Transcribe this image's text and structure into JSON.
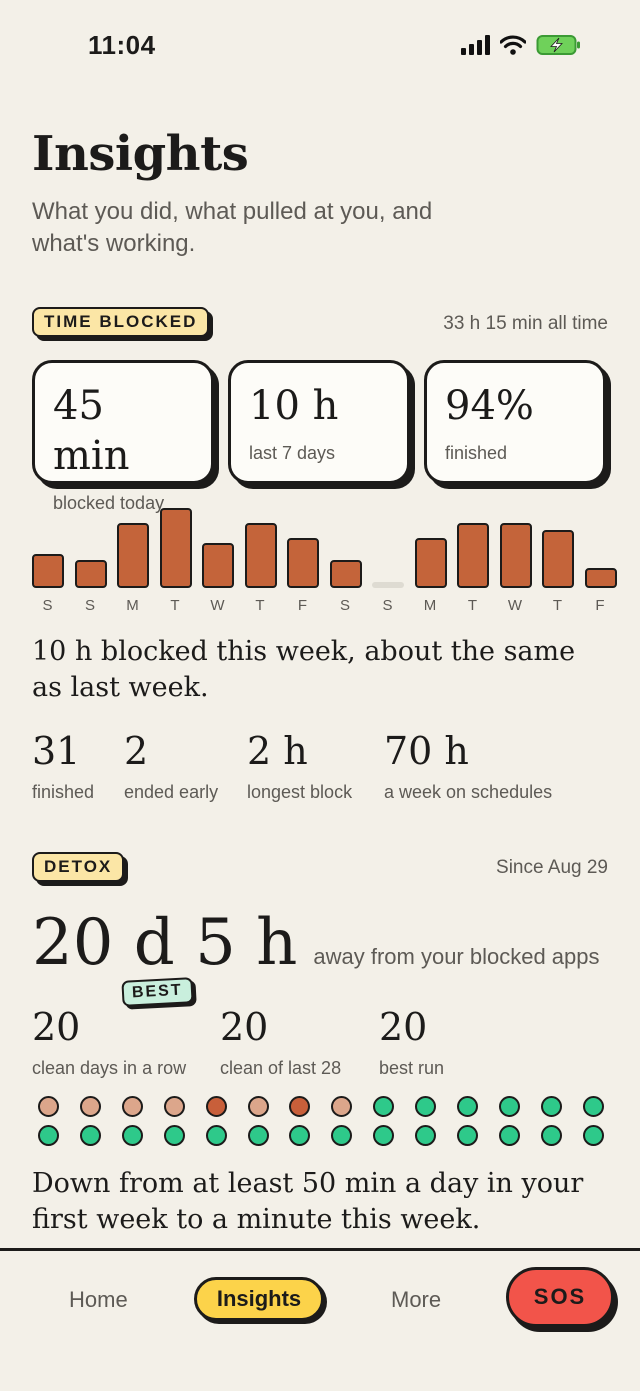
{
  "status": {
    "time": "11:04"
  },
  "header": {
    "title": "Insights",
    "subtitle": "What you did, what pulled at you, and what's working."
  },
  "time_blocked": {
    "tag": "TIME BLOCKED",
    "total": "33 h 15 min all time",
    "cards": [
      {
        "value": "45 min",
        "label": "blocked today"
      },
      {
        "value": "10 h",
        "label": "last 7 days"
      },
      {
        "value": "94%",
        "label": "finished"
      }
    ],
    "chart_data": {
      "type": "bar",
      "categories": [
        "S",
        "S",
        "M",
        "T",
        "W",
        "T",
        "F",
        "S",
        "S",
        "M",
        "T",
        "W",
        "T",
        "F"
      ],
      "values": [
        34,
        28,
        65,
        80,
        45,
        65,
        50,
        28,
        0,
        50,
        65,
        65,
        58,
        20
      ],
      "title": "",
      "xlabel": "",
      "ylabel": ""
    },
    "summary": "10 h blocked this week, about the same as last week.",
    "stats": [
      {
        "value": "31",
        "label": "finished"
      },
      {
        "value": "2",
        "label": "ended early"
      },
      {
        "value": "2 h",
        "label": "longest block"
      },
      {
        "value": "70 h",
        "label": "a week on schedules"
      }
    ]
  },
  "detox": {
    "tag": "DETOX",
    "since": "Since Aug 29",
    "value": "20 d 5 h",
    "caption": "away from your blocked apps",
    "badge": "BEST",
    "stats": [
      {
        "value": "20",
        "label": "clean days in a row"
      },
      {
        "value": "20",
        "label": "clean of last 28"
      },
      {
        "value": "20",
        "label": "best run"
      }
    ],
    "days": [
      "light",
      "light",
      "light",
      "light",
      "dark",
      "light",
      "dark",
      "light",
      "clean",
      "clean",
      "clean",
      "clean",
      "clean",
      "clean",
      "clean",
      "clean",
      "clean",
      "clean",
      "clean",
      "clean",
      "clean",
      "clean",
      "clean",
      "clean",
      "clean",
      "clean",
      "clean",
      "clean"
    ],
    "day_colors": {
      "light": "#dca68b",
      "dark": "#c85f3a",
      "clean": "#2ec98a"
    },
    "summary": "Down from at least 50 min a day in your first week to a minute this week."
  },
  "nav": {
    "home": "Home",
    "insights": "Insights",
    "more": "More",
    "sos": "SOS"
  }
}
